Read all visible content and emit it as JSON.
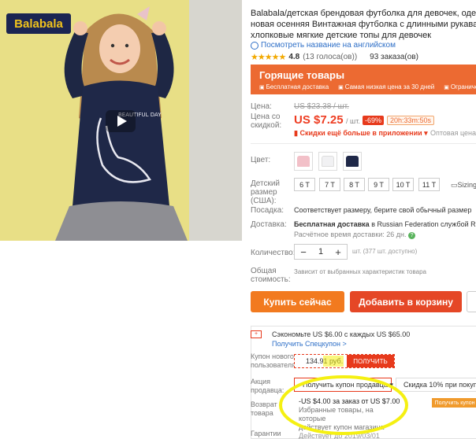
{
  "image": {
    "brand_logo": "Balabala"
  },
  "product": {
    "title_lines": [
      "Balabala/детская брендовая футболка для девочек, одежда 2",
      "новая осенняя Винтажная футболка с длинными рукавами д",
      "хлопковые мягкие детские топы для девочек"
    ],
    "translate_link": "Посмотреть название на английском",
    "rating_stars": "★★★★★",
    "rating_value": "4.8",
    "votes": "(13 голоса(ов))",
    "orders": "93 заказа(ов)"
  },
  "hot_deals": {
    "title": "Горящие товары",
    "features": [
      "Бесплатная доставка",
      "Самая низкая цена за 30 дней",
      "Ограничен"
    ]
  },
  "price": {
    "label_price": "Цена:",
    "old_price": "US $23.38 / шт.",
    "label_discount_price": [
      "Цена со",
      "скидкой:"
    ],
    "current_price": "US $7.25",
    "per_unit": "/ шт.",
    "discount": "-69%",
    "timer": "20h:33m:50s",
    "app_discount": "Скидки ещё больше в приложении ▾",
    "wholesale": "Оптовая цена ▾"
  },
  "options": {
    "color_label": "Цвет:",
    "size_label": [
      "Детский",
      "размер",
      "(США):"
    ],
    "sizes": [
      "6 T",
      "7 T",
      "8 T",
      "9 T",
      "10 T",
      "11 T"
    ],
    "size_chart": "Sizing",
    "fit_label": "Посадка:",
    "fit_value": "Соответствует размеру, берите свой обычный размер",
    "delivery_label": "Доставка:",
    "delivery_value": "Бесплатная доставка",
    "delivery_route": " в Russian Federation службой Russ",
    "delivery_time": "Расчётное время доставки: 26 дн.",
    "quantity_label": "Количество:",
    "quantity": "1",
    "quantity_note": "шт. (377 шт. доступно)",
    "total_label": [
      "Общая",
      "стоимость:"
    ],
    "total_value": "Зависит от выбранных характеристик товара"
  },
  "actions": {
    "buy_now": "Купить сейчас",
    "add_to_cart": "Добавить в корзину"
  },
  "coupons": {
    "save_text": "Сэкономьте US $6.00 с каждых US $65.00",
    "spec_link": "Получить Спецкупон >",
    "new_user_label": [
      "Купон нового",
      "пользователя"
    ],
    "new_user_amount": "134.91 руб.",
    "get_button": "ПОЛУЧИТЬ",
    "seller_label": [
      "Акция",
      "продавца:"
    ],
    "seller_button": "Получить купон продавца ▾",
    "seller_button2": "Скидка 10% при покупке",
    "return_label": [
      "Возврат",
      "товара"
    ],
    "guarantee_label": "Гарантии",
    "coupon_line1": "-US $4.00 за заказ от US $7.00",
    "coupon_line2": "Избранные товары, на которые",
    "coupon_line3": "действует купон магазина",
    "coupon_line4": "Действует до 2019/03/01",
    "mini_get": "Получить купон"
  },
  "colors": {
    "accent": "#ee3d22",
    "hot_banner": "#ec6a32",
    "link": "#2e6fc7",
    "highlight": "#f5f012"
  }
}
